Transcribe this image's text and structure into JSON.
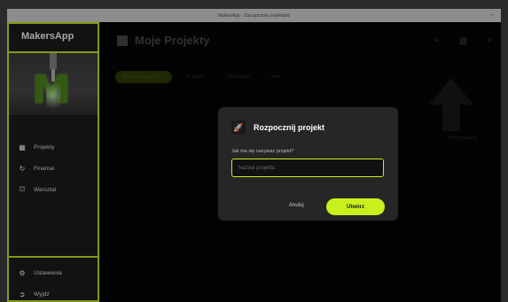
{
  "window": {
    "title": "MakersApp - Zarządzanie projektami",
    "close_glyph": "–"
  },
  "sidebar": {
    "app_title": "MakersApp",
    "items": [
      {
        "label": "Projekty",
        "icon": "projects-icon"
      },
      {
        "label": "Finanse",
        "icon": "finance-icon"
      },
      {
        "label": "Warsztat",
        "icon": "workshop-icon"
      }
    ],
    "bottom_items": [
      {
        "label": "Ustawienia",
        "icon": "settings-icon"
      },
      {
        "label": "Wyjdź",
        "icon": "logout-icon"
      }
    ]
  },
  "main": {
    "title": "Moje Projekty",
    "tabs": [
      {
        "label": "Wszystkie projekty"
      },
      {
        "label": "W trakcie"
      },
      {
        "label": "Zakończone"
      },
      {
        "label": "Inne"
      }
    ],
    "empty_text": "Brak projektów"
  },
  "dialog": {
    "title": "Rozpocznij projekt",
    "icon": "rocket-icon",
    "field_label": "Jak ma się nazywać projekt?",
    "field_placeholder": "Nazwa projektu",
    "field_value": "",
    "cancel_label": "Anuluj",
    "create_label": "Utwórz"
  },
  "colors": {
    "accent": "#c7f01d",
    "sidebar_bg": "#1c1c1c",
    "dialog_bg": "#262626"
  }
}
